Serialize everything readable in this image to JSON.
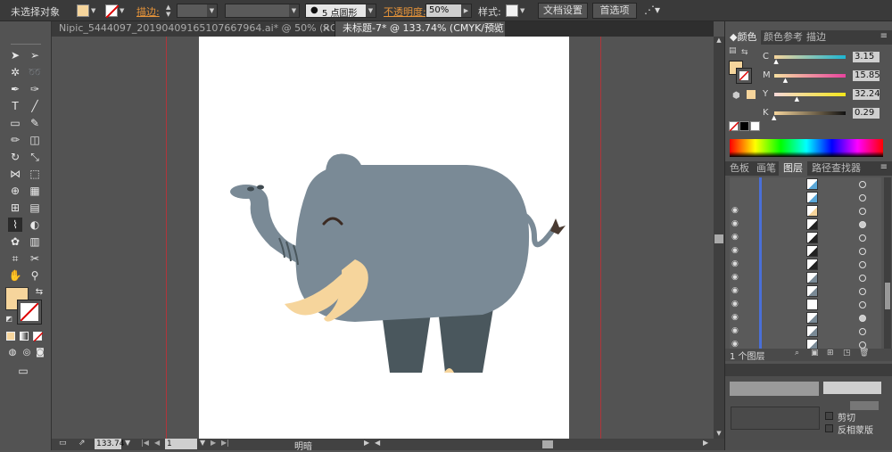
{
  "control_bar": {
    "selection_label": "未选择对象",
    "fill_color": "#f6d59c",
    "stroke_label": "描边:",
    "brush_label": "5 点圆形",
    "opacity_label": "不透明度:",
    "opacity_value": "50%",
    "style_label": "样式:",
    "doc_setup_button": "文档设置",
    "prefs_button": "首选项"
  },
  "document_tabs": [
    {
      "title": "Nipic_5444097_20190409165107667964.ai* @ 50% (RGB/预览)",
      "active": false
    },
    {
      "title": "未标题-7* @ 133.74% (CMYK/预览)",
      "active": true
    }
  ],
  "tools": [
    "selection-icon",
    "direct-selection-icon",
    "magic-wand-icon",
    "lasso-icon",
    "pen-icon",
    "curvature-icon",
    "type-icon",
    "line-icon",
    "rectangle-icon",
    "paintbrush-icon",
    "pencil-icon",
    "eraser-icon",
    "rotate-icon",
    "scale-icon",
    "width-icon",
    "free-transform-icon",
    "shape-builder-icon",
    "perspective-icon",
    "mesh-icon",
    "gradient-icon",
    "eyedropper-icon",
    "blend-icon",
    "symbol-sprayer-icon",
    "column-graph-icon",
    "artboard-icon",
    "slice-icon",
    "hand-icon",
    "zoom-icon"
  ],
  "color_panel": {
    "tabs": [
      "颜色",
      "颜色参考",
      "描边"
    ],
    "channels": [
      {
        "label": "C",
        "value": "3.15",
        "fraction": 0.03
      },
      {
        "label": "M",
        "value": "15.85",
        "fraction": 0.16
      },
      {
        "label": "Y",
        "value": "32.24",
        "fraction": 0.32
      },
      {
        "label": "K",
        "value": "0.29",
        "fraction": 0.0
      }
    ]
  },
  "layers_panel": {
    "tabs": [
      "色板",
      "画笔",
      "图层",
      "路径查找器"
    ],
    "footer_label": "1 个图层",
    "rows": 13
  },
  "bottom_panel": {
    "labels": [
      "剪切",
      "反相蒙版"
    ]
  },
  "status_bar": {
    "zoom": "133.74",
    "page": "1",
    "status_text": "明暗"
  },
  "colors": {
    "elephant_body": "#7a8a96",
    "elephant_legs": "#4a575d",
    "tusk": "#f6d59c",
    "fill_swatch": "#f6d59c",
    "guide": "#b0353a"
  }
}
